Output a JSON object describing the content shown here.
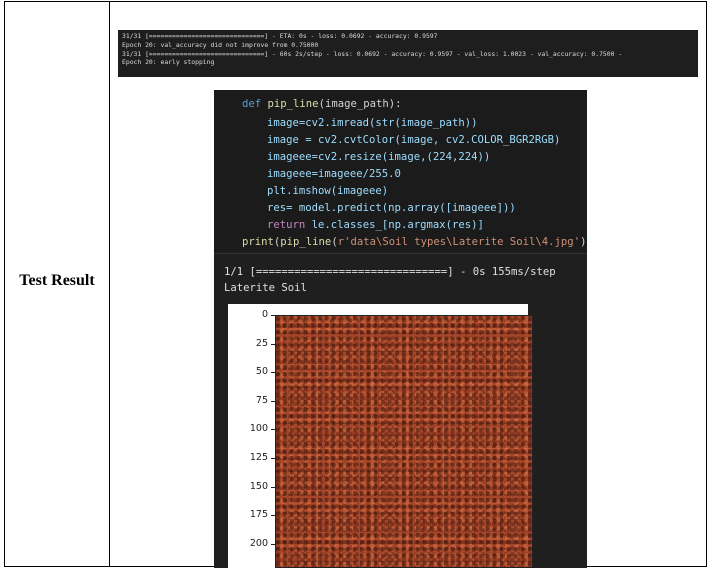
{
  "table": {
    "row_label": "Test Result"
  },
  "log": {
    "lines": [
      "31/31 [==============================] - ETA: 0s - loss: 0.0692 - accuracy: 0.9597",
      "Epoch 20: val_accuracy did not improve from 0.75000",
      "31/31 [==============================] - 60s 2s/step - loss: 0.0692 - accuracy: 0.9597 - val_loss: 1.0023 - val_accuracy: 0.7500 -",
      "Epoch 20: early stopping"
    ]
  },
  "code": {
    "line1": {
      "kw": "def",
      "fn": "pip_line",
      "rest": "(image_path):"
    },
    "line2": "image=cv2.imread(str(image_path))",
    "line3": "image = cv2.cvtColor(image, cv2.COLOR_BGR2RGB)",
    "line4": "imageee=cv2.resize(image,(224,224))",
    "line5": "imageee=imageee/255.0",
    "line6": "plt.imshow(imageee)",
    "line7": "res= model.predict(np.array([imageee]))",
    "line8": {
      "kw": "return",
      "rest": "le.classes_[np.argmax(res)]"
    },
    "line9": {
      "fn1": "print",
      "p1": "(",
      "fn2": "pip_line",
      "p2": "(",
      "str": "r'data\\Soil types\\Laterite Soil\\4.jpg'",
      "end": "))"
    }
  },
  "output": {
    "progress": "1/1 [==============================] - 0s 155ms/step",
    "prediction": "Laterite Soil"
  },
  "plot": {
    "y_ticks": [
      "0",
      "25",
      "50",
      "75",
      "100",
      "125",
      "150",
      "175",
      "200"
    ]
  },
  "colors": {
    "keyword": "#569cd6",
    "function": "#dcdcaa",
    "string": "#ce9178",
    "notebook_bg": "#1f1f1f",
    "soil": "#a5452a"
  }
}
